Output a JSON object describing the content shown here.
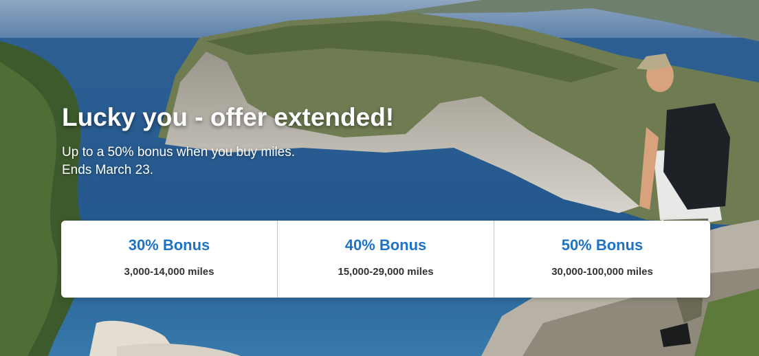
{
  "hero": {
    "headline": "Lucky you - offer extended!",
    "subtext_line1": "Up to a 50% bonus when you buy miles.",
    "subtext_line2": "Ends March 23."
  },
  "bonus_tiers": [
    {
      "title": "30% Bonus",
      "range": "3,000-14,000 miles"
    },
    {
      "title": "40% Bonus",
      "range": "15,000-29,000 miles"
    },
    {
      "title": "50% Bonus",
      "range": "30,000-100,000 miles"
    }
  ],
  "colors": {
    "accent": "#1f73c6",
    "tier_range_text": "#333333",
    "headline_text": "#ffffff",
    "card_background": "#ffffff"
  }
}
